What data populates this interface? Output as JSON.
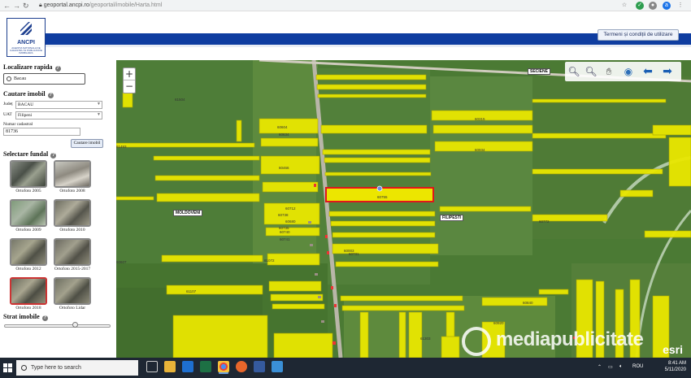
{
  "browser": {
    "url_host": "geoportal.ancpi.ro",
    "url_path": "/geoportal/imobile/Harta.html",
    "back_icon": "arrow-left-icon",
    "forward_icon": "arrow-right-icon",
    "reload_icon": "reload-icon",
    "profile_initial": "a"
  },
  "header": {
    "logo_text": "ANCPI",
    "logo_subtext": "AGENTIA NATIONALA DE CADASTRU SI PUBLICITATE IMOBILIARA",
    "terms_label": "Termeni și condiții de utilizare",
    "brand_color": "#0f3da0"
  },
  "sidebar": {
    "quick_title": "Localizare rapida",
    "quick_value": "Bacau",
    "search_title": "Cautare imobil",
    "judet_label": "Județ",
    "judet_value": "BACAU",
    "uat_label": "UAT",
    "uat_value": "Filipeni",
    "cadastral_label": "Numar cadastral",
    "cadastral_value": "81736",
    "search_button": "Cautare imobil",
    "background_title": "Selectare fundal",
    "backgrounds": [
      {
        "label": "Ortofoto 2005"
      },
      {
        "label": "Ortofoto 2008"
      },
      {
        "label": "Ortofoto 2009"
      },
      {
        "label": "Ortofoto 2010"
      },
      {
        "label": "Ortofoto 2012"
      },
      {
        "label": "Ortofoto 2015-2017"
      },
      {
        "label": "Ortofoto 2018"
      },
      {
        "label": "Ortofoto Lidar"
      }
    ],
    "layer_title": "Strat imobile",
    "layer_opacity": 0.67
  },
  "map": {
    "zoom_in": "+",
    "zoom_out": "−",
    "parcels": [
      {
        "label": "61504"
      },
      {
        "label": "61493"
      },
      {
        "label": "60604"
      },
      {
        "label": "60315"
      },
      {
        "label": "60934"
      },
      {
        "label": "60466"
      },
      {
        "label": "60634"
      },
      {
        "label": "60755"
      },
      {
        "label": "60712"
      },
      {
        "label": "60680"
      },
      {
        "label": "61072"
      },
      {
        "label": "60607"
      },
      {
        "label": "60731"
      },
      {
        "label": "60735"
      },
      {
        "label": "60772"
      },
      {
        "label": "60840"
      },
      {
        "label": "61303"
      },
      {
        "label": "60003"
      },
      {
        "label": "60920"
      },
      {
        "label": "61107"
      },
      {
        "label": "60738"
      },
      {
        "label": "60740"
      },
      {
        "label": "60741"
      }
    ],
    "highlighted_parcel": "81736",
    "place_labels": [
      "SECIENE",
      "MOLDOVENI",
      "FILIPESTI"
    ],
    "attribution": "esri",
    "watermark": "mediapublicitate"
  },
  "taskbar": {
    "search_placeholder": "Type here to search",
    "time": "8:41 AM",
    "date": "5/11/2020",
    "language": "ROU"
  }
}
